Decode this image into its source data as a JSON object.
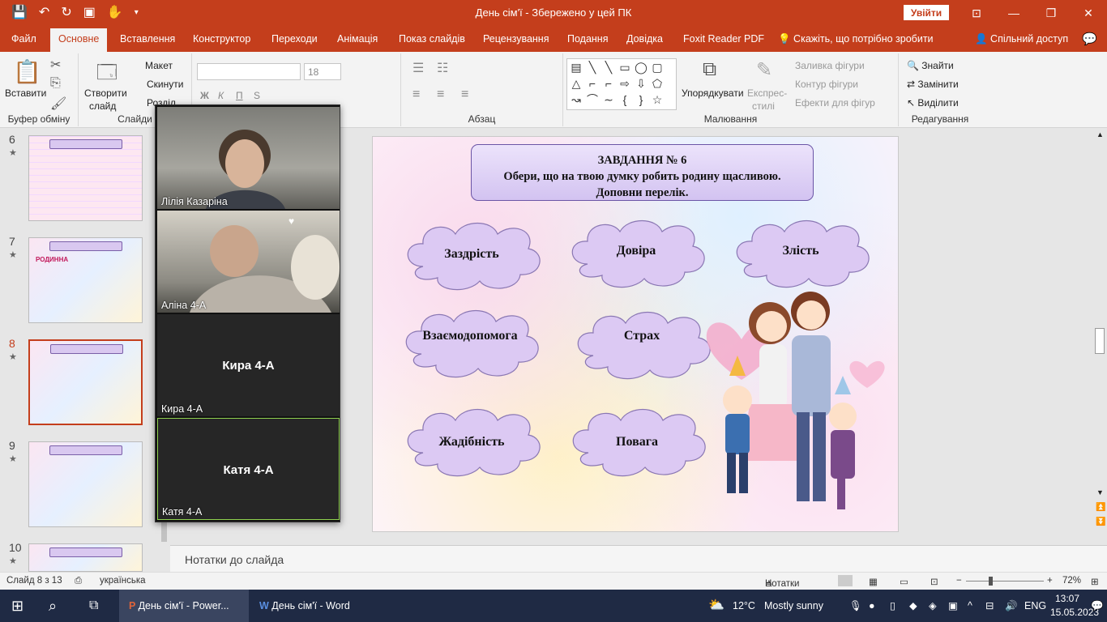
{
  "window": {
    "title": "День сім'ї  -  Збережено у цей ПК",
    "signin": "Увійти"
  },
  "tabs": [
    "Файл",
    "Основне",
    "Вставлення",
    "Конструктор",
    "Переходи",
    "Анімація",
    "Показ слайдів",
    "Рецензування",
    "Подання",
    "Довідка",
    "Foxit Reader PDF",
    "Скажіть, що потрібно зробити",
    "Спільний доступ"
  ],
  "ribbon": {
    "paste": "Вставити",
    "clipboard": "Буфер обміну",
    "new_slide_1": "Створити",
    "new_slide_2": "слайд",
    "layout": "Макет",
    "reset": "Скинути",
    "section": "Розділ",
    "slides": "Слайди",
    "font_size": "18",
    "paragraph": "Абзац",
    "arrange": "Упорядкувати",
    "quick_styles_1": "Експрес-",
    "quick_styles_2": "стилі",
    "shape_fill": "Заливка фігури",
    "shape_outline": "Контур фігури",
    "shape_effects": "Ефекти для фігур",
    "drawing": "Малювання",
    "find": "Знайти",
    "replace": "Замінити",
    "select": "Виділити",
    "editing": "Редагування",
    "font_b": "Ж",
    "font_i": "К",
    "font_u": "П",
    "font_s": "S"
  },
  "thumbnails": [
    {
      "num": "6",
      "star": "★"
    },
    {
      "num": "7",
      "star": "★",
      "word": "РОДИННА"
    },
    {
      "num": "8",
      "star": "★",
      "selected": true
    },
    {
      "num": "9",
      "star": "★"
    },
    {
      "num": "10",
      "star": "★"
    }
  ],
  "slide": {
    "task_title": "ЗАВДАННЯ № 6",
    "task_line1": "Обери, що на твою думку робить родину щасливою.",
    "task_line2": "Доповни перелік.",
    "clouds": [
      "Заздрість",
      "Довіра",
      "Злість",
      "Взаємодопомога",
      "Страх",
      "Жадібність",
      "Повага"
    ]
  },
  "video_participants": [
    {
      "name": "Лілія Казаріна",
      "camera": true
    },
    {
      "name": "Аліна 4-А",
      "camera": true
    },
    {
      "name": "Кира 4-А",
      "label": "Кира 4-А",
      "camera": false
    },
    {
      "name": "Катя  4-А",
      "label": "Катя  4-А",
      "camera": false
    }
  ],
  "notes_placeholder": "Нотатки до слайда",
  "status": {
    "slide": "Слайд 8 з 13",
    "language": "українська",
    "notes": "Нотатки",
    "zoom": "72%"
  },
  "taskbar": {
    "ppt": "День сім'ї - Power...",
    "word": "День сім'ї - Word",
    "weather_temp": "12°C",
    "weather_desc": "Mostly sunny",
    "lang": "ENG",
    "time": "13:07",
    "date": "15.05.2023"
  },
  "colors": {
    "accent": "#c43e1c",
    "cloud": "#dcc9f3",
    "task_border": "#6b55a6"
  }
}
